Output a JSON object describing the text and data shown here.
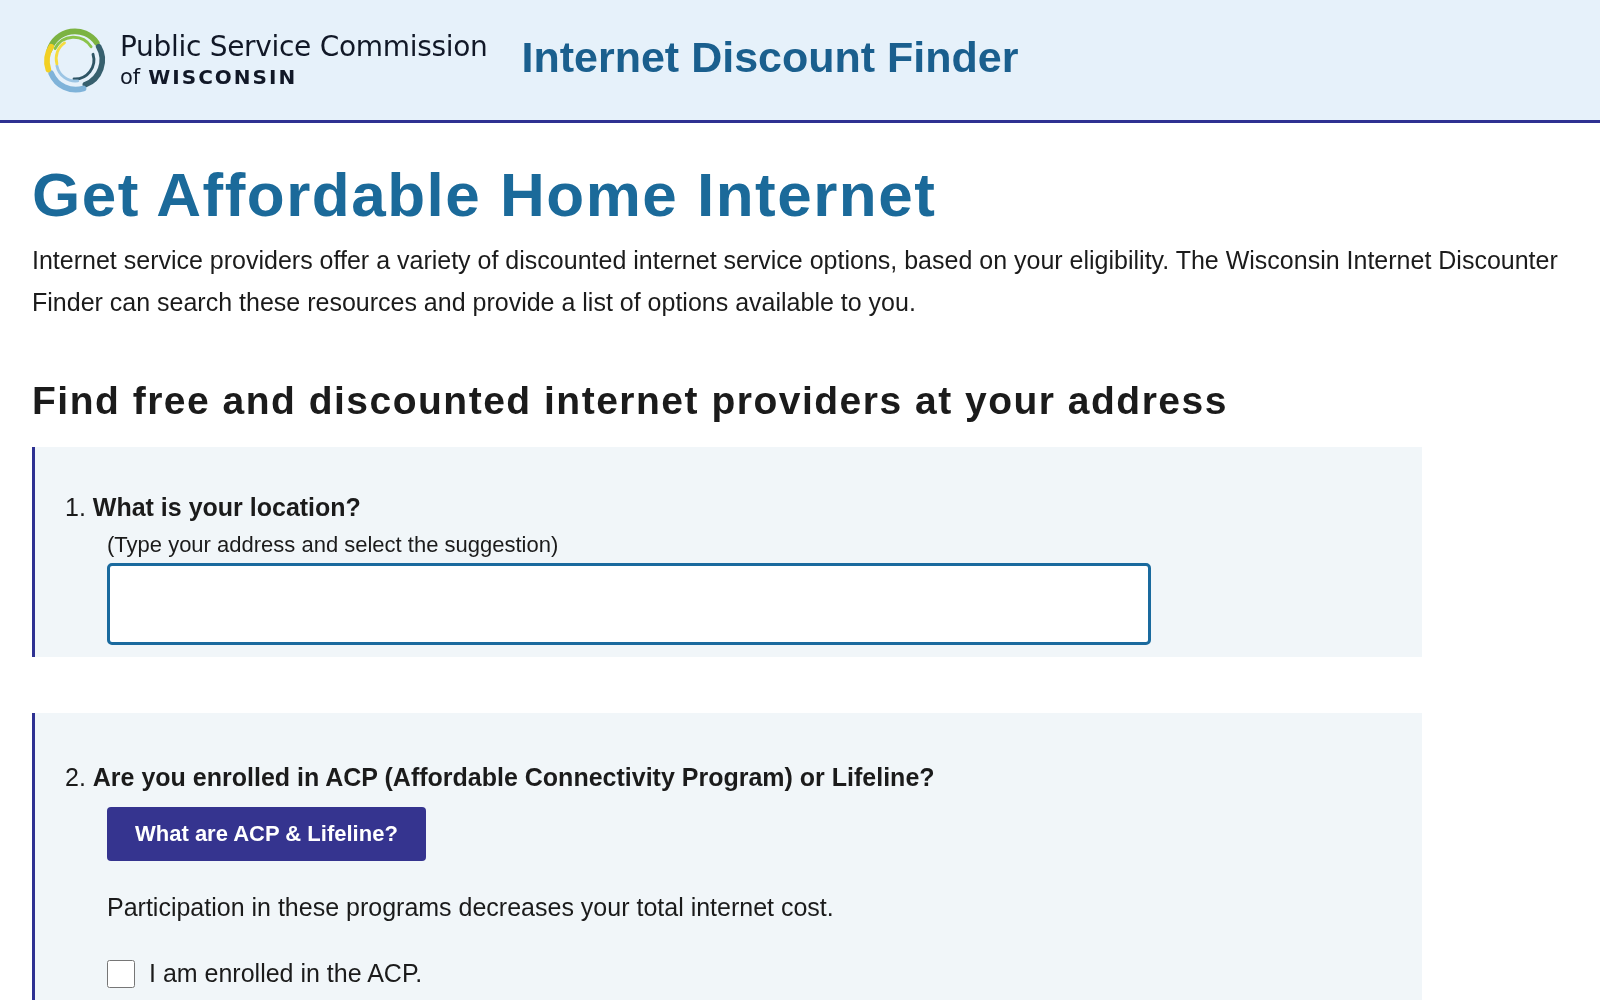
{
  "header": {
    "org_name": "Public Service Commission",
    "org_sub_prefix": "of",
    "org_sub": "WISCONSIN",
    "app_title": "Internet Discount Finder"
  },
  "page": {
    "title": "Get Affordable Home Internet",
    "intro": "Internet service providers offer a variety of discounted internet service options, based on your eligibility. The Wisconsin Internet Discounter Finder can search these resources and provide a list of options available to you.",
    "section_title": "Find free and discounted internet providers at your address"
  },
  "questions": [
    {
      "kind": "address",
      "text": "1. **What is your location?**",
      "hint": "(Type your address and select the suggestion)"
    },
    {
      "kind": "programs",
      "text": "2. **Are you enrolled in ACP (Affordable Connectivity Program) or Lifeline?**",
      "button": "What are ACP & Lifeline?",
      "note": "Participation in these programs decreases your total internet cost.",
      "options": [
        {
          "label": "I am enrolled in the ACP.",
          "checked": false
        }
      ]
    }
  ]
}
